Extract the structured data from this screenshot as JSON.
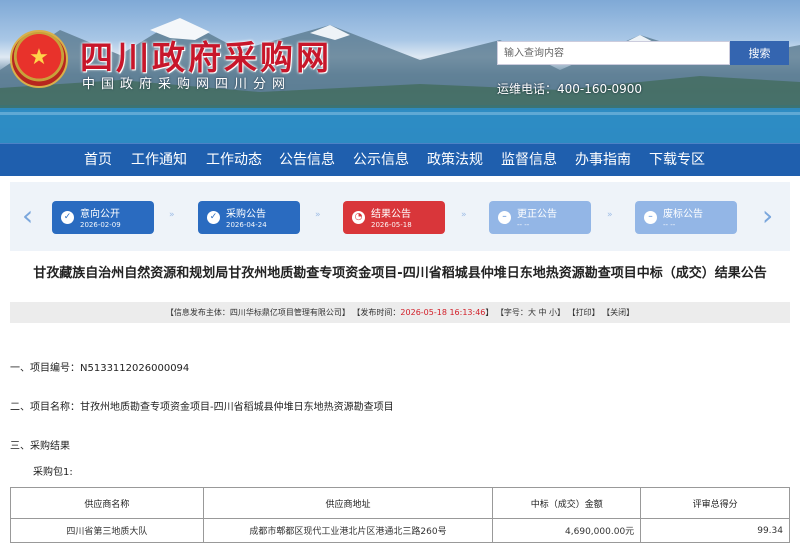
{
  "header": {
    "site_title": "四川政府采购网",
    "site_subtitle": "中国政府采购网四川分网",
    "emblem_icon": "national-emblem",
    "search": {
      "placeholder": "输入查询内容",
      "button": "搜索"
    },
    "hotline": "运维电话：400-160-0900"
  },
  "nav": {
    "items": [
      "首页",
      "工作通知",
      "工作动态",
      "公告信息",
      "公示信息",
      "政策法规",
      "监督信息",
      "办事指南",
      "下载专区"
    ]
  },
  "steps": [
    {
      "label": "意向公开",
      "date": "2026-02-09",
      "state": "done",
      "color": "#2a6bc0"
    },
    {
      "label": "采购公告",
      "date": "2026-04-24",
      "state": "done",
      "color": "#2a6bc0"
    },
    {
      "label": "结果公告",
      "date": "2026-05-18",
      "state": "current",
      "color": "#d9363a"
    },
    {
      "label": "更正公告",
      "date": "-- --",
      "state": "inactive",
      "color": "#93b6e6"
    },
    {
      "label": "废标公告",
      "date": "-- --",
      "state": "inactive",
      "color": "#93b6e6"
    }
  ],
  "document": {
    "title": "甘孜藏族自治州自然资源和规划局甘孜州地质勘查专项资金项目-四川省稻城县仲堆日东地热资源勘查项目中标（成交）结果公告",
    "meta": {
      "publisher": "【信息发布主体：四川华标鼎亿项目管理有限公司】",
      "time_label": "【发布时间：",
      "time_value": "2026-05-18 16:13:46",
      "time_end": "】",
      "font_label": "【字号：",
      "font_sizes": "大 中 小",
      "font_end": "】",
      "print": "【打印】",
      "close": "【关闭】"
    },
    "sections": {
      "s1": "一、项目编号：N5133112026000094",
      "s2": "二、项目名称：甘孜州地质勘查专项资金项目-四川省稻城县仲堆日东地热资源勘查项目",
      "s3": "三、采购结果",
      "pkg": "采购包1:"
    },
    "table": {
      "headers": [
        "供应商名称",
        "供应商地址",
        "中标（成交）金额",
        "评审总得分"
      ],
      "rows": [
        [
          "四川省第三地质大队",
          "成都市郫都区现代工业港北片区港通北三路260号",
          "4,690,000.00元",
          "99.34"
        ]
      ]
    }
  }
}
